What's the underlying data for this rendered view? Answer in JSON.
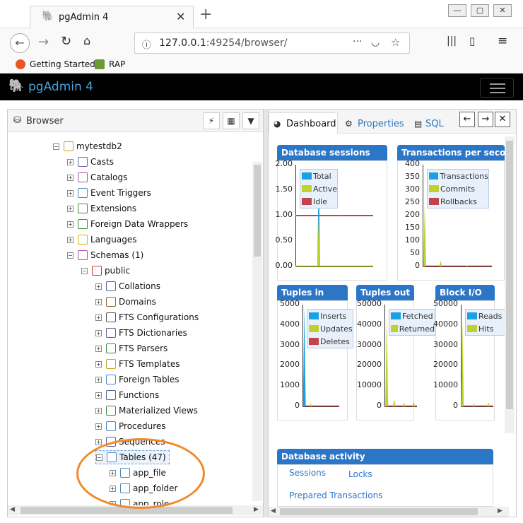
{
  "browser": {
    "tab_title": "pgAdmin 4",
    "url_host": "127.0.0.1",
    "url_rest": ":49254/browser/",
    "bookmarks": [
      "Getting Started",
      "RAP"
    ]
  },
  "app": {
    "title": "pgAdmin 4"
  },
  "left": {
    "panel_title": "Browser",
    "tree": [
      {
        "label": "mytestdb2",
        "level": 0,
        "exp": "−"
      },
      {
        "label": "Casts",
        "level": 1,
        "exp": "+"
      },
      {
        "label": "Catalogs",
        "level": 1,
        "exp": "+"
      },
      {
        "label": "Event Triggers",
        "level": 1,
        "exp": "+"
      },
      {
        "label": "Extensions",
        "level": 1,
        "exp": "+"
      },
      {
        "label": "Foreign Data Wrappers",
        "level": 1,
        "exp": "+"
      },
      {
        "label": "Languages",
        "level": 1,
        "exp": "+"
      },
      {
        "label": "Schemas (1)",
        "level": 1,
        "exp": "−"
      },
      {
        "label": "public",
        "level": 2,
        "exp": "−"
      },
      {
        "label": "Collations",
        "level": 3,
        "exp": "+"
      },
      {
        "label": "Domains",
        "level": 3,
        "exp": "+"
      },
      {
        "label": "FTS Configurations",
        "level": 3,
        "exp": "+"
      },
      {
        "label": "FTS Dictionaries",
        "level": 3,
        "exp": "+"
      },
      {
        "label": "FTS Parsers",
        "level": 3,
        "exp": "+"
      },
      {
        "label": "FTS Templates",
        "level": 3,
        "exp": "+"
      },
      {
        "label": "Foreign Tables",
        "level": 3,
        "exp": "+"
      },
      {
        "label": "Functions",
        "level": 3,
        "exp": "+"
      },
      {
        "label": "Materialized Views",
        "level": 3,
        "exp": "+"
      },
      {
        "label": "Procedures",
        "level": 3,
        "exp": "+"
      },
      {
        "label": "Sequences",
        "level": 3,
        "exp": "+"
      },
      {
        "label": "Tables (47)",
        "level": 3,
        "exp": "−"
      },
      {
        "label": "app_file",
        "level": 4,
        "exp": "+"
      },
      {
        "label": "app_folder",
        "level": 4,
        "exp": "+"
      },
      {
        "label": "app_role",
        "level": 4,
        "exp": "+"
      }
    ]
  },
  "right": {
    "tabs": [
      "Dashboard",
      "Properties",
      "SQL"
    ],
    "activity_title": "Database activity",
    "activity_tabs": [
      "Sessions",
      "Locks",
      "Prepared Transactions"
    ]
  },
  "colors": {
    "accent": "#2c76c7",
    "blue": "#1ba1e2",
    "green": "#bfd22b",
    "red": "#c0444a",
    "annotation": "#f08a2a"
  },
  "chart_data": [
    {
      "type": "line",
      "title": "Database sessions",
      "y_ticks": [
        "2.00",
        "1.50",
        "1.00",
        "0.50",
        "0.00"
      ],
      "ylim": [
        0,
        2
      ],
      "series": [
        {
          "name": "Total",
          "color": "#1ba1e2"
        },
        {
          "name": "Active",
          "color": "#bfd22b"
        },
        {
          "name": "Idle",
          "color": "#c0444a"
        }
      ],
      "legend": "top-left"
    },
    {
      "type": "line",
      "title": "Transactions per second",
      "y_ticks": [
        "400",
        "350",
        "300",
        "250",
        "200",
        "150",
        "100",
        "50",
        "0"
      ],
      "ylim": [
        0,
        400
      ],
      "series": [
        {
          "name": "Transactions",
          "color": "#1ba1e2"
        },
        {
          "name": "Commits",
          "color": "#bfd22b"
        },
        {
          "name": "Rollbacks",
          "color": "#c0444a"
        }
      ],
      "legend": "top-left"
    },
    {
      "type": "line",
      "title": "Tuples in",
      "y_ticks": [
        "5000",
        "4000",
        "3000",
        "2000",
        "1000",
        "0"
      ],
      "ylim": [
        0,
        5000
      ],
      "series": [
        {
          "name": "Inserts",
          "color": "#1ba1e2"
        },
        {
          "name": "Updates",
          "color": "#bfd22b"
        },
        {
          "name": "Deletes",
          "color": "#c0444a"
        }
      ],
      "legend": "top-left"
    },
    {
      "type": "line",
      "title": "Tuples out",
      "y_ticks": [
        "50000",
        "40000",
        "30000",
        "20000",
        "10000",
        "0"
      ],
      "ylim": [
        0,
        50000
      ],
      "series": [
        {
          "name": "Fetched",
          "color": "#1ba1e2"
        },
        {
          "name": "Returned",
          "color": "#bfd22b"
        }
      ],
      "legend": "top-left"
    },
    {
      "type": "line",
      "title": "Block I/O",
      "y_ticks": [
        "50000",
        "40000",
        "30000",
        "20000",
        "10000",
        "0"
      ],
      "ylim": [
        0,
        50000
      ],
      "series": [
        {
          "name": "Reads",
          "color": "#1ba1e2"
        },
        {
          "name": "Hits",
          "color": "#bfd22b"
        }
      ],
      "legend": "top-left"
    }
  ]
}
